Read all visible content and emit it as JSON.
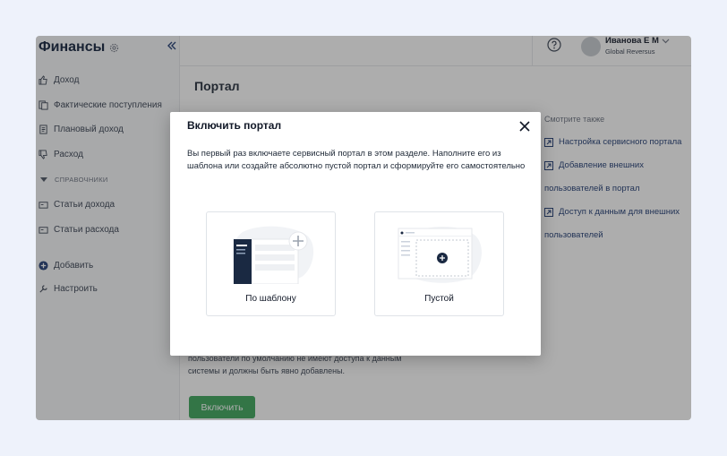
{
  "app": {
    "title": "Финансы"
  },
  "sidebar": {
    "items": [
      {
        "label": "Доход",
        "icon": "thumbs-up-icon"
      },
      {
        "label": "Фактические поступления",
        "icon": "documents-icon"
      },
      {
        "label": "Плановый доход",
        "icon": "document-icon"
      },
      {
        "label": "Расход",
        "icon": "thumbs-down-icon"
      }
    ],
    "section_title": "СПРАВОЧНИКИ",
    "ref_items": [
      {
        "label": "Статьи дохода",
        "icon": "card-icon"
      },
      {
        "label": "Статьи расхода",
        "icon": "card-icon"
      }
    ],
    "add_label": "Добавить",
    "settings_label": "Настроить"
  },
  "user": {
    "name": "Иванова Е М",
    "org": "Global Reversus"
  },
  "main": {
    "title": "Портал",
    "see_also_label": "Смотрите также",
    "links": [
      {
        "line1": "Настройка сервисного портала",
        "line2": ""
      },
      {
        "line1": "Добавление внешних",
        "line2": "пользователей в портал"
      },
      {
        "line1": "Доступ к данным для внешних",
        "line2": "пользователей"
      }
    ],
    "description_line1": "пользователи по умолчанию не имеют доступа к данным",
    "description_line2": "системы и должны быть явно добавлены.",
    "enable_label": "Включить"
  },
  "modal": {
    "title": "Включить портал",
    "text": "Вы первый раз включаете сервисный портал в этом разделе. Наполните его из шаблона или создайте абсолютно пустой портал и сформируйте его самостоятельно",
    "option_template": "По шаблону",
    "option_empty": "Пустой"
  },
  "colors": {
    "accent_green": "#3aa55a",
    "brand_navy": "#0f1f3a",
    "link_blue": "#1f3b73"
  }
}
